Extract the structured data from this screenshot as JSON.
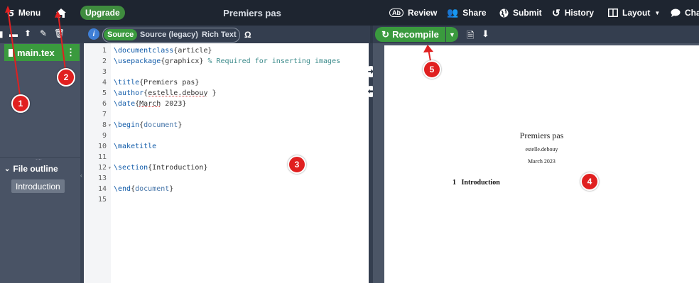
{
  "topbar": {
    "menu_label": "Menu",
    "upgrade_label": "Upgrade",
    "project_title": "Premiers pas",
    "review_label": "Review",
    "share_label": "Share",
    "submit_label": "Submit",
    "history_label": "History",
    "layout_label": "Layout",
    "chat_label": "Chat"
  },
  "editor_toolbar": {
    "source_label": "Source",
    "source_legacy_label": "Source (legacy)",
    "rich_text_label": "Rich Text",
    "symbol_label": "Ω"
  },
  "file_tree": {
    "file": "main.tex"
  },
  "outline": {
    "header": "File outline",
    "items": [
      "Introduction"
    ]
  },
  "editor": {
    "lines": [
      {
        "n": "1",
        "fold": "",
        "parts": [
          [
            "kw",
            "\\documentclass"
          ],
          [
            "",
            "{article}"
          ]
        ]
      },
      {
        "n": "2",
        "fold": "",
        "parts": [
          [
            "kw",
            "\\usepackage"
          ],
          [
            "",
            "{graphicx} "
          ],
          [
            "cm",
            "% Required for inserting images"
          ]
        ]
      },
      {
        "n": "3",
        "fold": "",
        "parts": []
      },
      {
        "n": "4",
        "fold": "",
        "parts": [
          [
            "kw",
            "\\title"
          ],
          [
            "",
            "{Premiers pas}"
          ]
        ]
      },
      {
        "n": "5",
        "fold": "",
        "parts": [
          [
            "kw",
            "\\author"
          ],
          [
            "",
            "{"
          ],
          [
            "u",
            "estelle.debouy"
          ],
          [
            "",
            " }"
          ]
        ]
      },
      {
        "n": "6",
        "fold": "",
        "parts": [
          [
            "kw",
            "\\date"
          ],
          [
            "",
            "{"
          ],
          [
            "u",
            "March"
          ],
          [
            "",
            " 2023}"
          ]
        ]
      },
      {
        "n": "7",
        "fold": "",
        "parts": []
      },
      {
        "n": "8",
        "fold": "▾",
        "parts": [
          [
            "kw",
            "\\begin"
          ],
          [
            "",
            "{"
          ],
          [
            "arg",
            "document"
          ],
          [
            "",
            "}"
          ]
        ]
      },
      {
        "n": "9",
        "fold": "",
        "parts": []
      },
      {
        "n": "10",
        "fold": "",
        "parts": [
          [
            "kw",
            "\\maketitle"
          ]
        ]
      },
      {
        "n": "11",
        "fold": "",
        "parts": []
      },
      {
        "n": "12",
        "fold": "▾",
        "parts": [
          [
            "kw",
            "\\section"
          ],
          [
            "",
            "{Introduction}"
          ]
        ]
      },
      {
        "n": "13",
        "fold": "",
        "parts": []
      },
      {
        "n": "14",
        "fold": "",
        "parts": [
          [
            "kw",
            "\\end"
          ],
          [
            "",
            "{"
          ],
          [
            "arg",
            "document"
          ],
          [
            "",
            "}"
          ]
        ]
      },
      {
        "n": "15",
        "fold": "",
        "parts": []
      }
    ]
  },
  "pdf_toolbar": {
    "recompile_label": "Recompile"
  },
  "pdf": {
    "title": "Premiers pas",
    "author": "estelle.debouy",
    "date": "March 2023",
    "section_number": "1",
    "section_title": "Introduction"
  },
  "markers": [
    "1",
    "2",
    "3",
    "4",
    "5"
  ],
  "colors": {
    "green": "#3a9a3e",
    "marker_red": "#e02020",
    "topbar": "#1e2530"
  }
}
